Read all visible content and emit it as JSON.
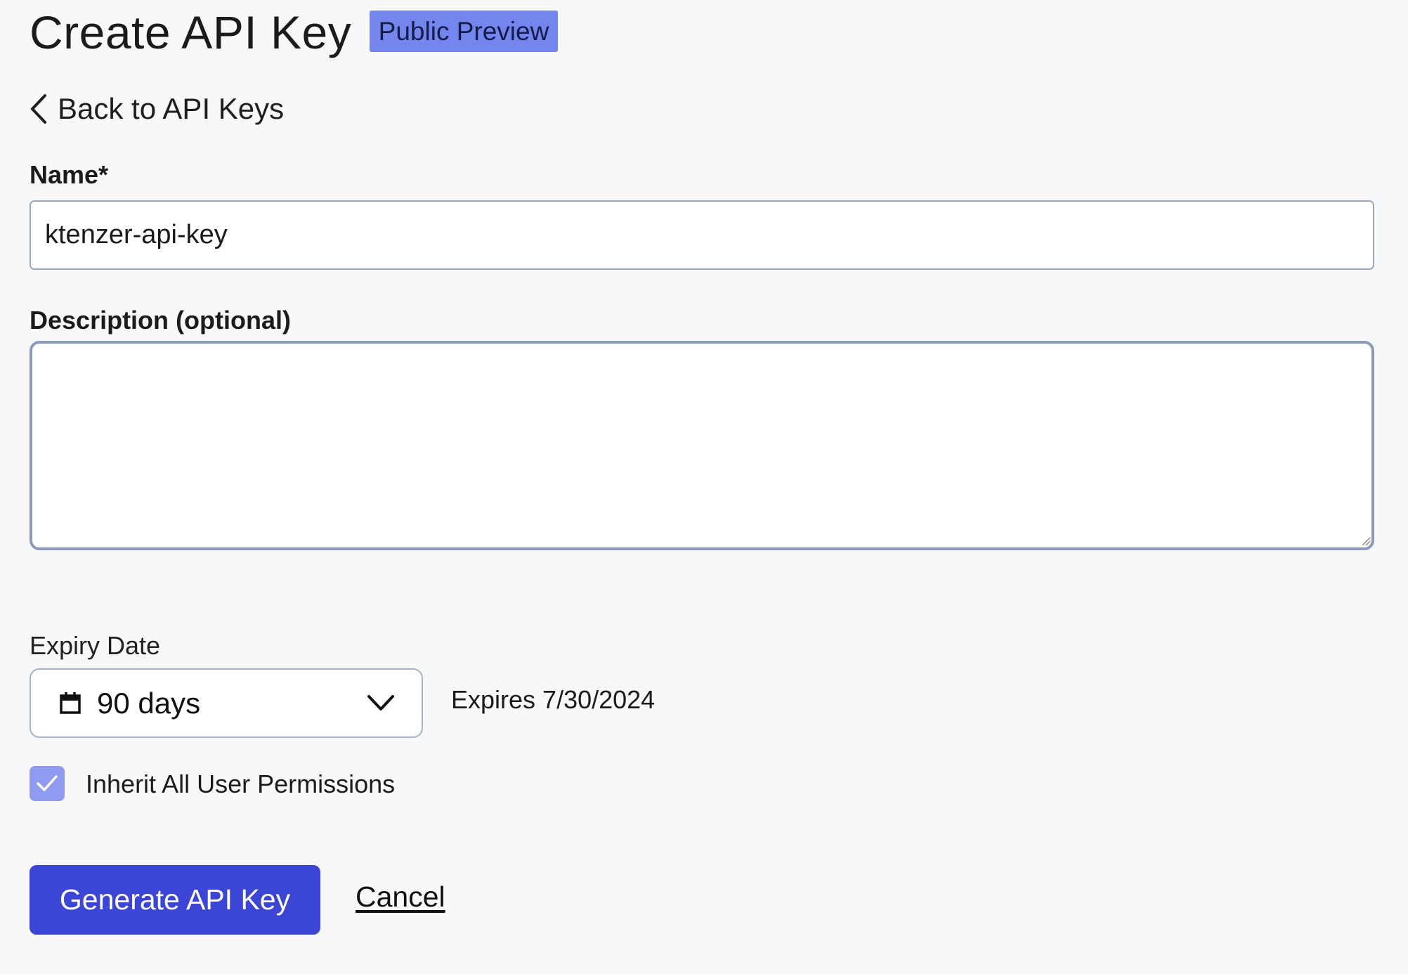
{
  "header": {
    "title": "Create API Key",
    "badge": "Public Preview"
  },
  "nav": {
    "back_label": "Back to API Keys",
    "back_icon": "chevron-left-icon"
  },
  "form": {
    "name": {
      "label": "Name*",
      "value": "ktenzer-api-key"
    },
    "description": {
      "label": "Description (optional)",
      "value": ""
    },
    "expiry": {
      "label": "Expiry Date",
      "selected": "90 days",
      "icon": "calendar-icon",
      "dropdown_icon": "chevron-down-icon",
      "expires_text": "Expires 7/30/2024"
    },
    "inherit_permissions": {
      "label": "Inherit All User Permissions",
      "checked": true,
      "icon": "check-icon"
    }
  },
  "actions": {
    "generate_label": "Generate API Key",
    "cancel_label": "Cancel"
  },
  "colors": {
    "background": "#f7f8fa",
    "badge": "#7585ee",
    "primary": "#3b45d8",
    "checkbox": "#8f9af1",
    "input_border": "#9aa6c0"
  }
}
